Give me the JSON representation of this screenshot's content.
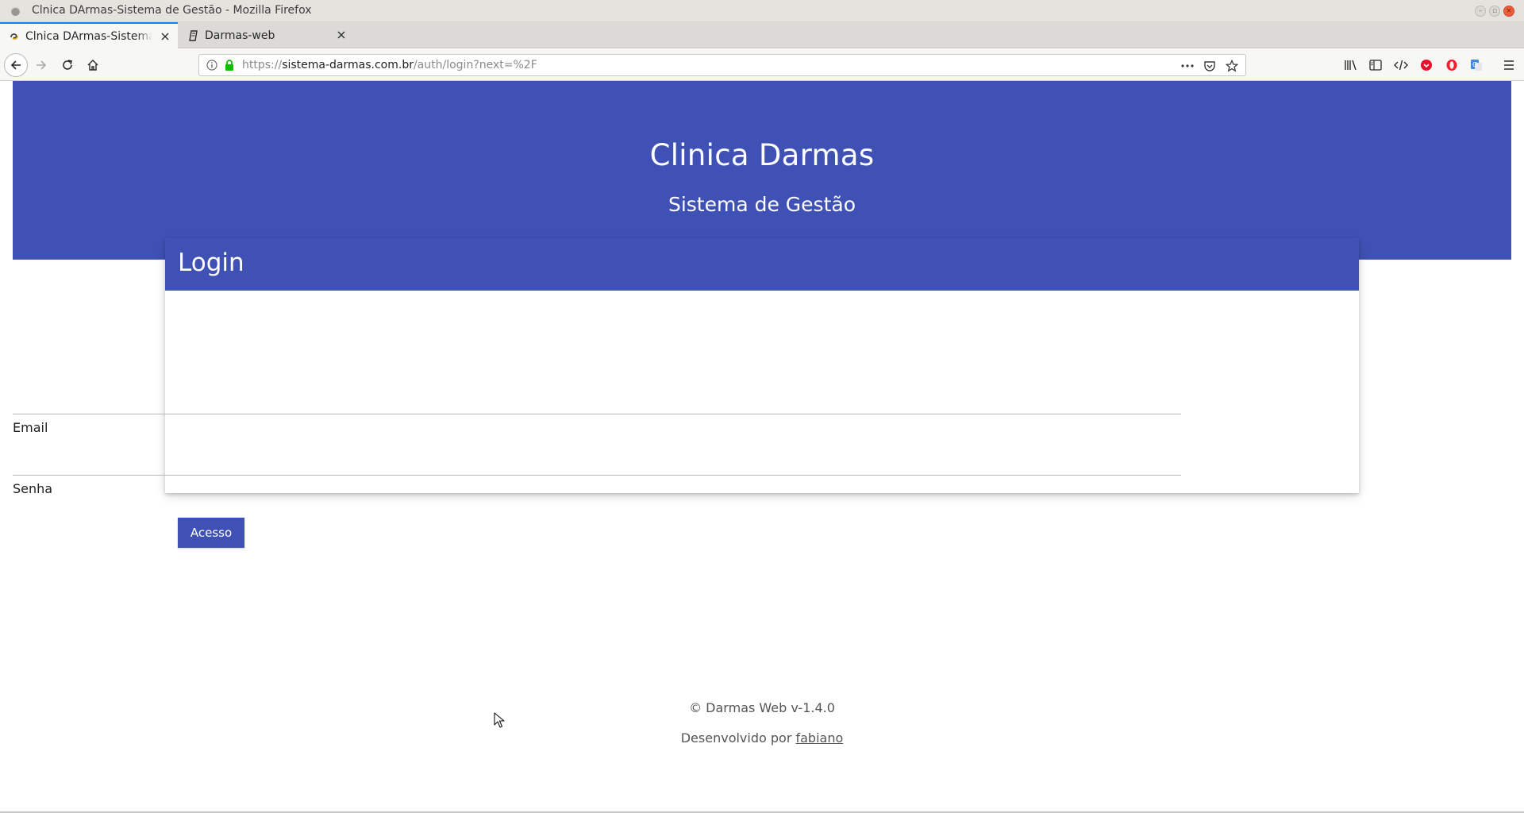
{
  "window": {
    "title": "Clnica DArmas-Sistema de Gestão - Mozilla Firefox"
  },
  "tabs": [
    {
      "label": "Clnica DArmas-Sistema de Gestão",
      "active": true,
      "icon": "site-favicon-icon"
    },
    {
      "label": "Darmas-web",
      "active": false,
      "icon": "document-icon"
    }
  ],
  "urlbar": {
    "scheme": "https://",
    "host": "sistema-darmas.com.br",
    "path": "/auth/login?next=%2F"
  },
  "colors": {
    "brand": "#3f51b5",
    "tab_accent": "#0a84ff"
  },
  "toolbar_icons": [
    "library-icon",
    "sidebar-icon",
    "developer-icon",
    "pocket-red-icon",
    "opera-icon",
    "translate-icon",
    "menu-icon"
  ],
  "hero": {
    "title": "Clinica Darmas",
    "subtitle": "Sistema de Gestão"
  },
  "login": {
    "title": "Login",
    "email_label": "Email",
    "email_value": "",
    "password_label": "Senha",
    "password_value": "",
    "submit_label": "Acesso"
  },
  "footer": {
    "copyright": "© Darmas Web v-1.4.0",
    "developed_by": "Desenvolvido por ",
    "developer_link": "fabiano"
  }
}
